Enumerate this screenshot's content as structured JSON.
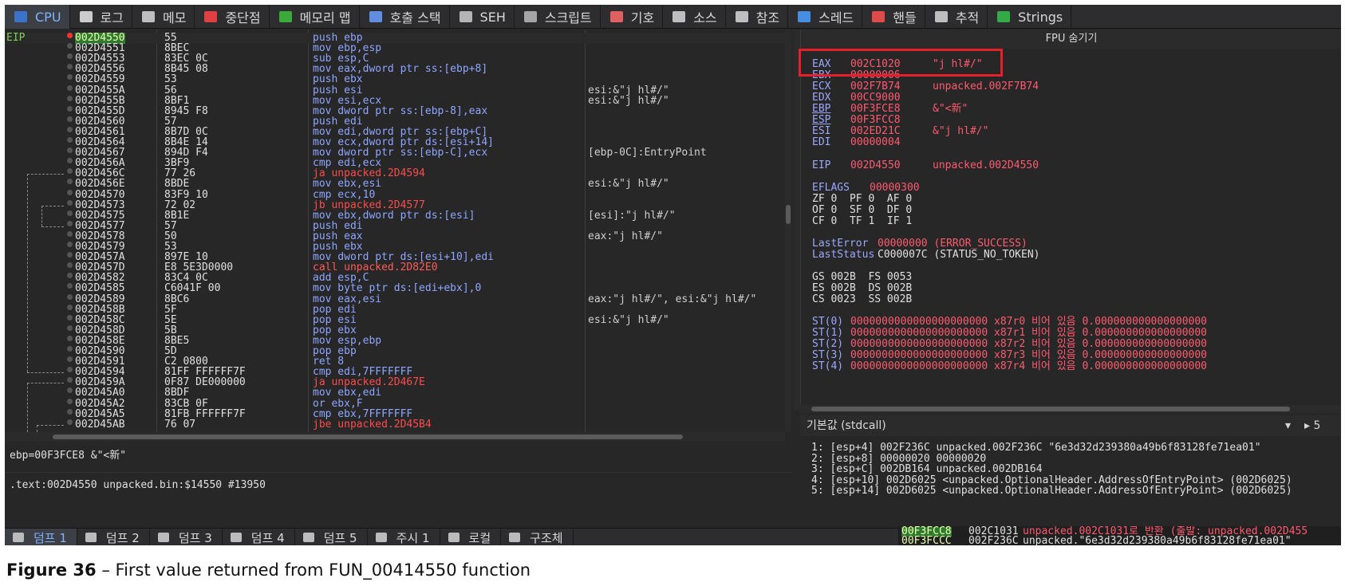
{
  "top_tabs": [
    {
      "label": "CPU",
      "icon": "cpu-icon",
      "active": true
    },
    {
      "label": "로그",
      "icon": "log-icon"
    },
    {
      "label": "메모",
      "icon": "notes-icon"
    },
    {
      "label": "중단점",
      "icon": "breakpoint-icon"
    },
    {
      "label": "메모리 맵",
      "icon": "memory-map-icon"
    },
    {
      "label": "호출 스택",
      "icon": "call-stack-icon"
    },
    {
      "label": "SEH",
      "icon": "seh-icon"
    },
    {
      "label": "스크립트",
      "icon": "script-icon"
    },
    {
      "label": "기호",
      "icon": "symbols-icon"
    },
    {
      "label": "소스",
      "icon": "source-icon"
    },
    {
      "label": "참조",
      "icon": "references-icon"
    },
    {
      "label": "스레드",
      "icon": "threads-icon"
    },
    {
      "label": "핸들",
      "icon": "handles-icon"
    },
    {
      "label": "추적",
      "icon": "trace-icon"
    },
    {
      "label": "Strings",
      "icon": "strings-icon"
    }
  ],
  "disasm": {
    "eip_label": "EIP",
    "rows": [
      {
        "addr": "002D4550",
        "bytes": "55",
        "instr": "push ebp",
        "comment": ""
      },
      {
        "addr": "002D4551",
        "bytes": "8BEC",
        "instr": "mov ebp,esp",
        "comment": ""
      },
      {
        "addr": "002D4553",
        "bytes": "83EC 0C",
        "instr": "sub esp,C",
        "comment": ""
      },
      {
        "addr": "002D4556",
        "bytes": "8B45 08",
        "instr": "mov eax,dword ptr ss:[ebp+8]",
        "comment": ""
      },
      {
        "addr": "002D4559",
        "bytes": "53",
        "instr": "push ebx",
        "comment": ""
      },
      {
        "addr": "002D455A",
        "bytes": "56",
        "instr": "push esi",
        "comment": "esi:&\"j hl#/\""
      },
      {
        "addr": "002D455B",
        "bytes": "8BF1",
        "instr": "mov esi,ecx",
        "comment": "esi:&\"j hl#/\""
      },
      {
        "addr": "002D455D",
        "bytes": "8945 F8",
        "instr": "mov dword ptr ss:[ebp-8],eax",
        "comment": ""
      },
      {
        "addr": "002D4560",
        "bytes": "57",
        "instr": "push edi",
        "comment": ""
      },
      {
        "addr": "002D4561",
        "bytes": "8B7D 0C",
        "instr": "mov edi,dword ptr ss:[ebp+C]",
        "comment": ""
      },
      {
        "addr": "002D4564",
        "bytes": "8B4E 14",
        "instr": "mov ecx,dword ptr ds:[esi+14]",
        "comment": ""
      },
      {
        "addr": "002D4567",
        "bytes": "894D F4",
        "instr": "mov dword ptr ss:[ebp-C],ecx",
        "comment": "[ebp-0C]:EntryPoint"
      },
      {
        "addr": "002D456A",
        "bytes": "3BF9",
        "instr": "cmp edi,ecx",
        "comment": ""
      },
      {
        "addr": "002D456C",
        "bytes": "77 26",
        "instr": "ja unpacked.2D4594",
        "comment": ""
      },
      {
        "addr": "002D456E",
        "bytes": "8BDE",
        "instr": "mov ebx,esi",
        "comment": "esi:&\"j hl#/\""
      },
      {
        "addr": "002D4570",
        "bytes": "83F9 10",
        "instr": "cmp ecx,10",
        "comment": ""
      },
      {
        "addr": "002D4573",
        "bytes": "72 02",
        "instr": "jb unpacked.2D4577",
        "comment": ""
      },
      {
        "addr": "002D4575",
        "bytes": "8B1E",
        "instr": "mov ebx,dword ptr ds:[esi]",
        "comment": "[esi]:\"j hl#/\""
      },
      {
        "addr": "002D4577",
        "bytes": "57",
        "instr": "push edi",
        "comment": ""
      },
      {
        "addr": "002D4578",
        "bytes": "50",
        "instr": "push eax",
        "comment": "eax:\"j hl#/\""
      },
      {
        "addr": "002D4579",
        "bytes": "53",
        "instr": "push ebx",
        "comment": ""
      },
      {
        "addr": "002D457A",
        "bytes": "897E 10",
        "instr": "mov dword ptr ds:[esi+10],edi",
        "comment": ""
      },
      {
        "addr": "002D457D",
        "bytes": "E8 5E3D0000",
        "instr": "call unpacked.2D82E0",
        "comment": ""
      },
      {
        "addr": "002D4582",
        "bytes": "83C4 0C",
        "instr": "add esp,C",
        "comment": ""
      },
      {
        "addr": "002D4585",
        "bytes": "C6041F 00",
        "instr": "mov byte ptr ds:[edi+ebx],0",
        "comment": ""
      },
      {
        "addr": "002D4589",
        "bytes": "8BC6",
        "instr": "mov eax,esi",
        "comment": "eax:\"j hl#/\", esi:&\"j hl#/\""
      },
      {
        "addr": "002D458B",
        "bytes": "5F",
        "instr": "pop edi",
        "comment": ""
      },
      {
        "addr": "002D458C",
        "bytes": "5E",
        "instr": "pop esi",
        "comment": "esi:&\"j hl#/\""
      },
      {
        "addr": "002D458D",
        "bytes": "5B",
        "instr": "pop ebx",
        "comment": ""
      },
      {
        "addr": "002D458E",
        "bytes": "8BE5",
        "instr": "mov esp,ebp",
        "comment": ""
      },
      {
        "addr": "002D4590",
        "bytes": "5D",
        "instr": "pop ebp",
        "comment": ""
      },
      {
        "addr": "002D4591",
        "bytes": "C2 0800",
        "instr": "ret 8",
        "comment": ""
      },
      {
        "addr": "002D4594",
        "bytes": "81FF FFFFFF7F",
        "instr": "cmp edi,7FFFFFFF",
        "comment": ""
      },
      {
        "addr": "002D459A",
        "bytes": "0F87 DE000000",
        "instr": "ja unpacked.2D467E",
        "comment": ""
      },
      {
        "addr": "002D45A0",
        "bytes": "8BDF",
        "instr": "mov ebx,edi",
        "comment": ""
      },
      {
        "addr": "002D45A2",
        "bytes": "83CB 0F",
        "instr": "or ebx,F",
        "comment": ""
      },
      {
        "addr": "002D45A5",
        "bytes": "81FB FFFFFF7F",
        "instr": "cmp ebx,7FFFFFFF",
        "comment": ""
      },
      {
        "addr": "002D45AB",
        "bytes": "76 07",
        "instr": "jbe unpacked.2D45B4",
        "comment": ""
      }
    ],
    "info_line": "ebp=00F3FCE8 &\"<新\"",
    "section_line": ".text:002D4550 unpacked.bin:$14550 #13950"
  },
  "registers": {
    "header": "FPU 숨기기",
    "gpr": [
      {
        "name": "EAX",
        "value": "002C1020",
        "note": "\"j hl#/\""
      },
      {
        "name": "EBX",
        "value": "00000006",
        "note": ""
      },
      {
        "name": "ECX",
        "value": "002F7B74",
        "note": "unpacked.002F7B74"
      },
      {
        "name": "EDX",
        "value": "00CC9000",
        "note": ""
      },
      {
        "name": "EBP",
        "value": "00F3FCE8",
        "note": "&\"<新\""
      },
      {
        "name": "ESP",
        "value": "00F3FCC8",
        "note": ""
      },
      {
        "name": "ESI",
        "value": "002ED21C",
        "note": "&\"j hl#/\""
      },
      {
        "name": "EDI",
        "value": "00000004",
        "note": ""
      }
    ],
    "eip": {
      "name": "EIP",
      "value": "002D4550",
      "note": "unpacked.002D4550"
    },
    "eflags": {
      "name": "EFLAGS",
      "value": "00000300"
    },
    "flags_rows": [
      "ZF 0  PF 0  AF 0",
      "OF 0  SF 0  DF 0",
      "CF 0  TF 1  IF 1"
    ],
    "last_error": {
      "name": "LastError",
      "value": "00000000 (ERROR_SUCCESS)"
    },
    "last_status": {
      "name": "LastStatus",
      "value": "C000007C (STATUS_NO_TOKEN)"
    },
    "seg_rows": [
      "GS 002B  FS 0053",
      "ES 002B  DS 002B",
      "CS 0023  SS 002B"
    ],
    "fpu_rows": [
      {
        "name": "ST(0)",
        "value": "0000000000000000000000 x87r0 비어 있음 0.000000000000000000"
      },
      {
        "name": "ST(1)",
        "value": "0000000000000000000000 x87r1 비어 있음 0.000000000000000000"
      },
      {
        "name": "ST(2)",
        "value": "0000000000000000000000 x87r2 비어 있음 0.000000000000000000"
      },
      {
        "name": "ST(3)",
        "value": "0000000000000000000000 x87r3 비어 있음 0.000000000000000000"
      },
      {
        "name": "ST(4)",
        "value": "0000000000000000000000 x87r4 비어 있음 0.000000000000000000"
      }
    ]
  },
  "call_convention": {
    "label": "기본값 (stdcall)",
    "count": "5",
    "args": [
      "1: [esp+4] 002F236C unpacked.002F236C \"6e3d32d239380a49b6f83128fe71ea01\"",
      "2: [esp+8] 00000020 00000020",
      "3: [esp+C] 002DB164 unpacked.002DB164",
      "4: [esp+10] 002D6025 <unpacked.OptionalHeader.AddressOfEntryPoint> (002D6025)",
      "5: [esp+14] 002D6025 <unpacked.OptionalHeader.AddressOfEntryPoint> (002D6025)"
    ]
  },
  "bottom_tabs": [
    {
      "label": "덤프 1",
      "active": true
    },
    {
      "label": "덤프 2"
    },
    {
      "label": "덤프 3"
    },
    {
      "label": "덤프 4"
    },
    {
      "label": "덤프 5"
    },
    {
      "label": "주시 1"
    },
    {
      "label": "로컬"
    },
    {
      "label": "구조체"
    }
  ],
  "stack": [
    {
      "addr": "00F3FCC8",
      "value": "002C1031",
      "comment": "unpacked.002C1031로 반환 (출발: unpacked.002D455"
    },
    {
      "addr": "00F3FCCC",
      "value": "002F236C",
      "comment": "unpacked.\"6e3d32d239380a49b6f83128fe71ea01\""
    }
  ],
  "caption": {
    "prefix": "Figure 36",
    "text": "  –  First value returned from FUN_00414550 function"
  },
  "colors": {
    "background": "#272727",
    "address_highlight": "#2f7a2f",
    "register_value": "#ff5a6e",
    "instruction": "#8ea6ff",
    "annotation_box": "#e5202c"
  }
}
